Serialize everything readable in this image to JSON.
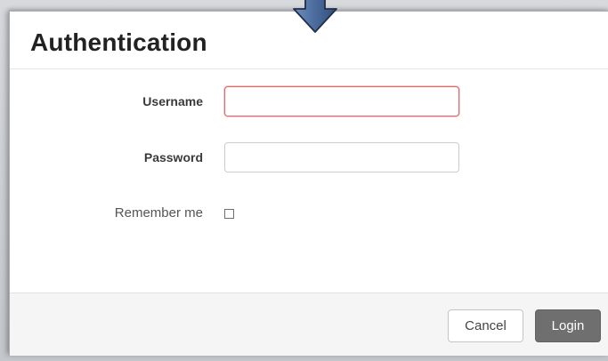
{
  "dialog": {
    "title": "Authentication"
  },
  "form": {
    "username": {
      "label": "Username",
      "value": "",
      "placeholder": ""
    },
    "password": {
      "label": "Password",
      "value": "",
      "placeholder": ""
    },
    "remember": {
      "label": "Remember me",
      "checked": false
    }
  },
  "footer": {
    "cancel_label": "Cancel",
    "login_label": "Login"
  },
  "colors": {
    "error_border": "#e06a6a",
    "primary_button": "#6f6f6f",
    "arrow_fill": "#4a6b9c"
  },
  "icons": {
    "pointer_arrow": "arrow-down-icon"
  }
}
